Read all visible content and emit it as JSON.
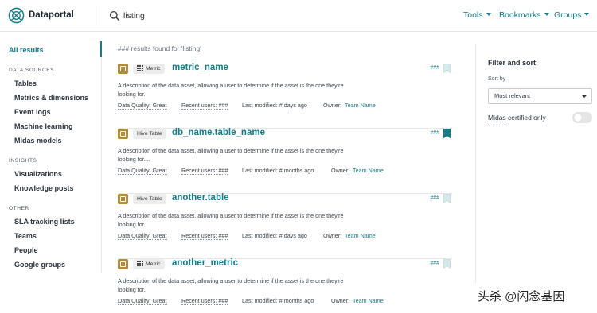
{
  "header": {
    "brand": "Dataportal",
    "search_value": "listing",
    "nav": [
      {
        "label": "Tools"
      },
      {
        "label": "Bookmarks"
      },
      {
        "label": "Groups"
      }
    ]
  },
  "sidebar": {
    "all_results": "All results",
    "sections": [
      {
        "heading": "DATA SOURCES",
        "items": [
          "Tables",
          "Metrics & dimensions",
          "Event logs",
          "Machine learning",
          "Midas models"
        ]
      },
      {
        "heading": "INSIGHTS",
        "items": [
          "Visualizations",
          "Knowledge posts"
        ]
      },
      {
        "heading": "OTHER",
        "items": [
          "SLA tracking lists",
          "Teams",
          "People",
          "Google groups"
        ]
      }
    ]
  },
  "results": {
    "count_text": "### results found for 'listing'",
    "cards": [
      {
        "type": "Metric",
        "title": "metric_name",
        "count": "###",
        "bookmarked": false,
        "desc_line1": "A description of the data asset, allowing a user to determine if the asset is the one they're",
        "desc_line2": "looking for.",
        "quality": "Data Quality: Great",
        "recent_users": "Recent users: ###",
        "last_modified": "Last modified: # days ago",
        "owner_label": "Owner:",
        "owner": "Team Name"
      },
      {
        "type": "Hive Table",
        "title": "db_name.table_name",
        "count": "###",
        "bookmarked": true,
        "desc_line1": "A description of the data asset, allowing a user to determine if the asset is the one they're",
        "desc_line2": "looking for....",
        "quality": "Data Quality: Great",
        "recent_users": "Recent users: ###",
        "last_modified": "Last modified: # months ago",
        "owner_label": "Owner:",
        "owner": "Team Name"
      },
      {
        "type": "Hive Table",
        "title": "another.table",
        "count": "###",
        "bookmarked": false,
        "desc_line1": "A description of the data asset, allowing a user to determine if the asset is the one they're",
        "desc_line2": "looking for.",
        "quality": "Data Quality: Great",
        "recent_users": "Recent users: ###",
        "last_modified": "Last modified: # days ago",
        "owner_label": "Owner:",
        "owner": "Team Name"
      },
      {
        "type": "Metric",
        "title": "another_metric",
        "count": "###",
        "bookmarked": false,
        "desc_line1": "A description of the data asset, allowing a user to determine if the asset is the one they're",
        "desc_line2": "looking for.",
        "quality": "Data Quality: Great",
        "recent_users": "Recent users: ###",
        "last_modified": "Last modified: # months ago",
        "owner_label": "Owner:",
        "owner": "Team Name"
      }
    ]
  },
  "filter": {
    "title": "Filter and sort",
    "sort_label": "Sort by",
    "sort_value": "Most relevant",
    "midas_label": "Midas",
    "midas_label_rest": " certified only",
    "midas_enabled": false
  },
  "watermark": "头杀 @闪念基因",
  "colors": {
    "accent": "#147c8a",
    "badge": "#b08a3e"
  },
  "icons": {
    "logo": "dataportal-logo-icon",
    "search": "search-icon",
    "bookmark": "bookmark-icon",
    "metric": "grid-icon",
    "type_badge": "asset-badge-icon"
  }
}
